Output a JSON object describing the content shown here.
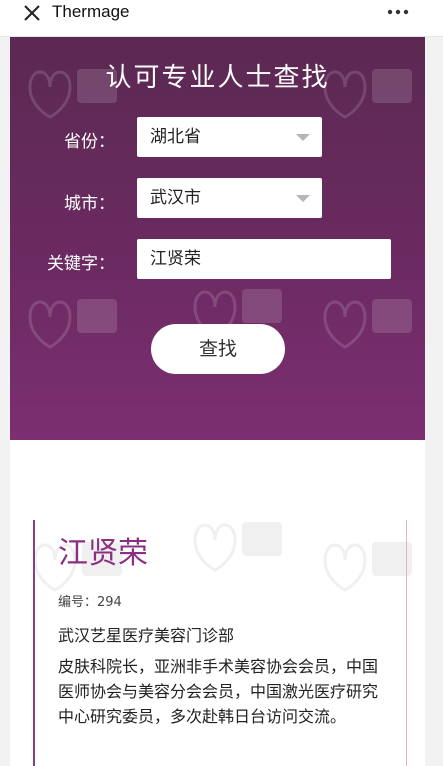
{
  "app": {
    "title": "Thermage"
  },
  "icons": {
    "close": "close-icon",
    "more": "more-icon",
    "watermark": "watermark-logo"
  },
  "colors": {
    "panel_purple": "#6b2a61",
    "name_purple": "#8a2f82",
    "white": "#ffffff"
  },
  "search": {
    "heading": "认可专业人士查找",
    "province_label": "省份：",
    "province_value": "湖北省",
    "city_label": "城市：",
    "city_value": "武汉市",
    "keyword_label": "关键字：",
    "keyword_value": "江贤荣",
    "button_label": "查找"
  },
  "result": {
    "name": "江贤荣",
    "id_text": "编号：294",
    "clinic": "武汉艺星医疗美容门诊部",
    "description": "皮肤科院长，亚洲非手术美容协会会员，中国医师协会与美容分会会员，中国激光医疗研究中心研究委员，多次赴韩日台访问交流。"
  }
}
